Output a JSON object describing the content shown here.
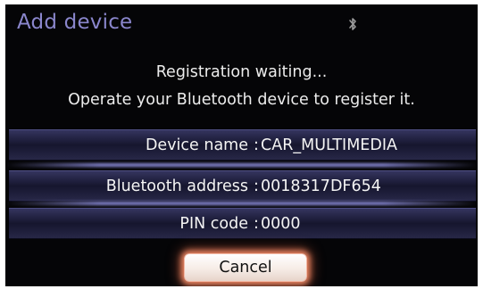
{
  "header": {
    "title": "Add device",
    "status_icon": "bluetooth-icon"
  },
  "message": {
    "line1": "Registration waiting...",
    "line2": "Operate your Bluetooth device to register it."
  },
  "device_info": [
    {
      "label": "Device name",
      "separator": ":",
      "value": "CAR_MULTIMEDIA"
    },
    {
      "label": "Bluetooth address",
      "separator": ":",
      "value": "0018317DF654"
    },
    {
      "label": "PIN code",
      "separator": ":",
      "value": "0000"
    }
  ],
  "actions": {
    "cancel_label": "Cancel"
  },
  "colors": {
    "background": "#050507",
    "title": "#8a86cc",
    "row_band": "#24244a",
    "button_glow": "#f08a66"
  }
}
